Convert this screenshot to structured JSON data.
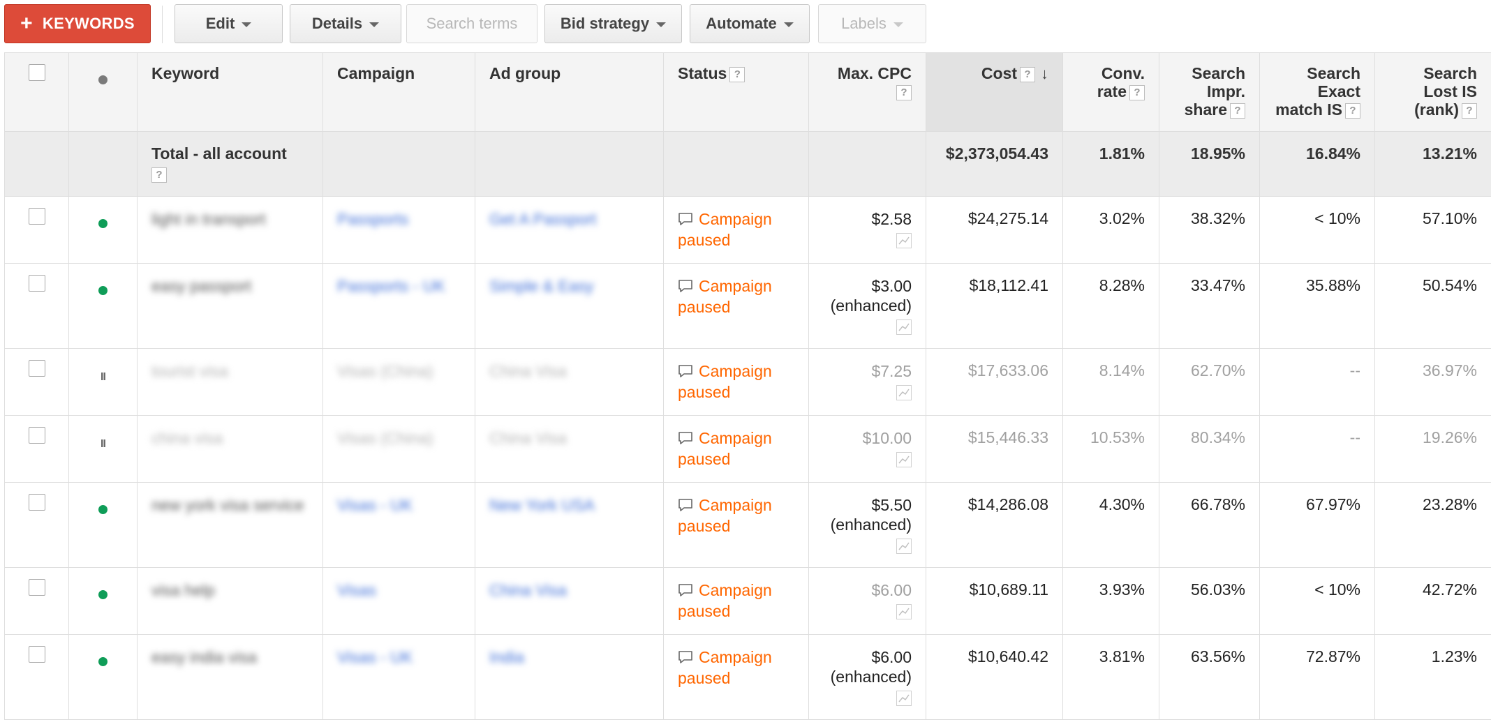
{
  "toolbar": {
    "add_keywords": "KEYWORDS",
    "edit": "Edit",
    "details": "Details",
    "search_terms": "Search terms",
    "bid_strategy": "Bid strategy",
    "automate": "Automate",
    "labels": "Labels"
  },
  "columns": {
    "keyword": "Keyword",
    "campaign": "Campaign",
    "ad_group": "Ad group",
    "status": "Status",
    "max_cpc": "Max. CPC",
    "cost": "Cost",
    "conv_rate": [
      "Conv.",
      "rate"
    ],
    "search_impr_share": [
      "Search",
      "Impr.",
      "share"
    ],
    "search_exact_match_is": [
      "Search",
      "Exact",
      "match IS"
    ],
    "search_lost_is_rank": [
      "Search",
      "Lost IS",
      "(rank)"
    ]
  },
  "total": {
    "label": "Total - all account",
    "cost": "$2,373,054.43",
    "conv_rate": "1.81%",
    "search_impr_share": "18.95%",
    "search_exact_match_is": "16.84%",
    "search_lost_is_rank": "13.21%"
  },
  "rows": [
    {
      "state": "enabled",
      "keyword": "light in transport",
      "campaign": "Passports",
      "ad_group": "Get A Passport",
      "status": [
        "Campaign",
        "paused"
      ],
      "max_cpc": "$2.58",
      "max_cpc_note": "",
      "cost": "$24,275.14",
      "conv_rate": "3.02%",
      "search_impr_share": "38.32%",
      "search_exact_match_is": "< 10%",
      "search_lost_is_rank": "57.10%"
    },
    {
      "state": "enabled",
      "keyword": "easy passport",
      "campaign": "Passports - UK",
      "ad_group": "Simple & Easy",
      "status": [
        "Campaign",
        "paused"
      ],
      "max_cpc": "$3.00",
      "max_cpc_note": "(enhanced)",
      "cost": "$18,112.41",
      "conv_rate": "8.28%",
      "search_impr_share": "33.47%",
      "search_exact_match_is": "35.88%",
      "search_lost_is_rank": "50.54%"
    },
    {
      "state": "paused",
      "keyword": "tourist visa",
      "campaign": "Visas (China)",
      "ad_group": "China Visa",
      "status": [
        "Campaign",
        "paused"
      ],
      "max_cpc": "$7.25",
      "max_cpc_note": "",
      "cost": "$17,633.06",
      "conv_rate": "8.14%",
      "search_impr_share": "62.70%",
      "search_exact_match_is": "--",
      "search_lost_is_rank": "36.97%"
    },
    {
      "state": "paused",
      "keyword": "china visa",
      "campaign": "Visas (China)",
      "ad_group": "China Visa",
      "status": [
        "Campaign",
        "paused"
      ],
      "max_cpc": "$10.00",
      "max_cpc_note": "",
      "cost": "$15,446.33",
      "conv_rate": "10.53%",
      "search_impr_share": "80.34%",
      "search_exact_match_is": "--",
      "search_lost_is_rank": "19.26%"
    },
    {
      "state": "enabled",
      "keyword": "new york visa service",
      "campaign": "Visas - UK",
      "ad_group": "New York USA",
      "status": [
        "Campaign",
        "paused"
      ],
      "max_cpc": "$5.50",
      "max_cpc_note": "(enhanced)",
      "cost": "$14,286.08",
      "conv_rate": "4.30%",
      "search_impr_share": "66.78%",
      "search_exact_match_is": "67.97%",
      "search_lost_is_rank": "23.28%"
    },
    {
      "state": "enabled",
      "keyword": "visa help",
      "campaign": "Visas",
      "ad_group": "China Visa",
      "status": [
        "Campaign",
        "paused"
      ],
      "max_cpc": "$6.00",
      "max_cpc_note": "",
      "cost": "$10,689.11",
      "conv_rate": "3.93%",
      "search_impr_share": "56.03%",
      "search_exact_match_is": "< 10%",
      "search_lost_is_rank": "42.72%"
    },
    {
      "state": "enabled",
      "keyword": "easy india visa",
      "campaign": "Visas - UK",
      "ad_group": "India",
      "status": [
        "Campaign",
        "paused"
      ],
      "max_cpc": "$6.00",
      "max_cpc_note": "(enhanced)",
      "cost": "$10,640.42",
      "conv_rate": "3.81%",
      "search_impr_share": "63.56%",
      "search_exact_match_is": "72.87%",
      "search_lost_is_rank": "1.23%"
    }
  ],
  "colors": {
    "primary_button": "#dd4b39",
    "status_link": "#ff6600",
    "enabled_dot": "#0f9d58",
    "link": "#3f6fd8"
  }
}
